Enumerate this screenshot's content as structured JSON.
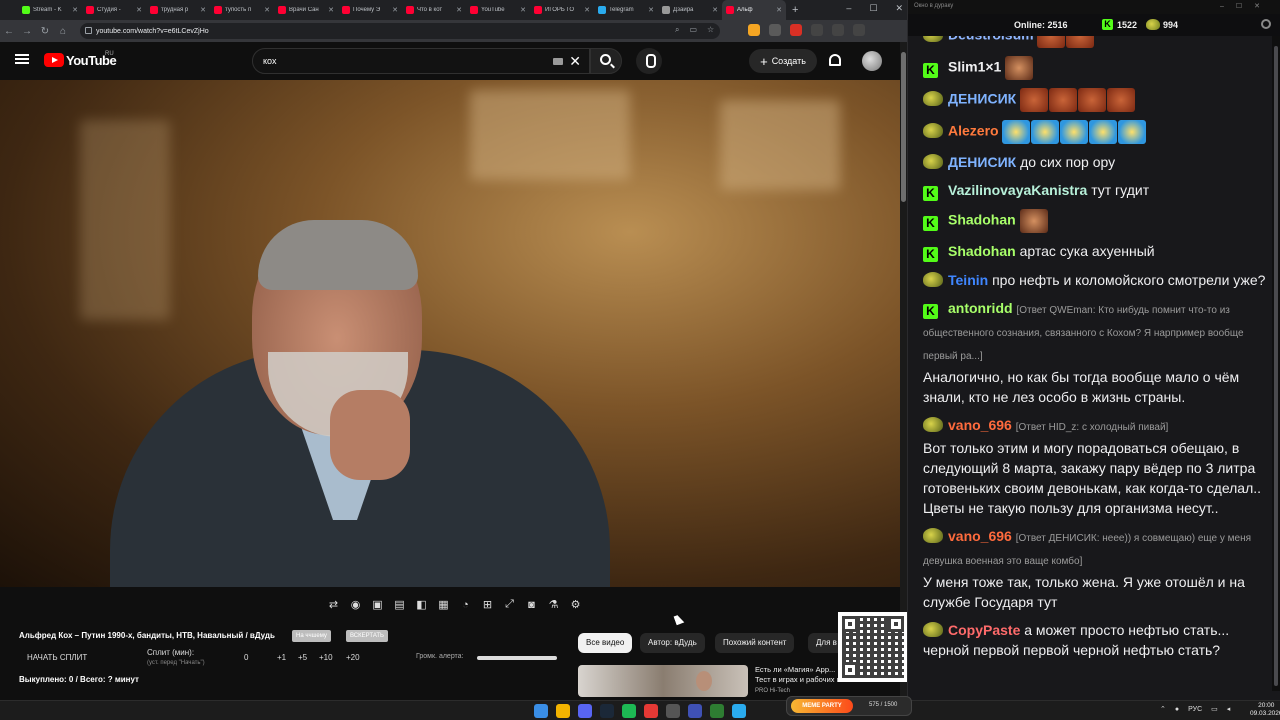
{
  "browser": {
    "tabs": [
      {
        "label": "Stream - K",
        "color": "#53fc18"
      },
      {
        "label": "Студия -",
        "color": "#ff0033"
      },
      {
        "label": "трудная р",
        "color": "#ff0033"
      },
      {
        "label": "тупость п",
        "color": "#ff0033"
      },
      {
        "label": "Врачи Сан",
        "color": "#ff0033"
      },
      {
        "label": "Почему Э",
        "color": "#ff0033"
      },
      {
        "label": "Что в кот",
        "color": "#ff0033"
      },
      {
        "label": "YouTube",
        "color": "#ff0033"
      },
      {
        "label": "ИГОРЬ ГО",
        "color": "#ff0033"
      },
      {
        "label": "Telegram",
        "color": "#2aabee"
      },
      {
        "label": "Дзайра",
        "color": "#999999"
      },
      {
        "label": "Альф",
        "color": "#ff0033",
        "active": true
      }
    ],
    "url": "youtube.com/watch?v=e6tLCevZjHo"
  },
  "youtube": {
    "logo_text": "YouTube",
    "region": "RU",
    "search_value": "кох",
    "create_label": "Создать",
    "video_title": "Альфред Кох – Путин 1990-х, бандиты, НТВ, Навальный / вДудь",
    "pill_1": "На ччшему",
    "pill_2": "ВСКЕРТАТЬ",
    "split_button": "НАЧАТЬ СПЛИТ",
    "split_label": "Сплит (мин):",
    "split_hint": "(уст. перед \"Начать\")",
    "split_values": [
      "0",
      "+1",
      "+5",
      "+10",
      "+20"
    ],
    "alert_label": "Громк. алерта:",
    "alert_volume": 1.0,
    "bought": "Выкуплено: 0 / Всего: ? минут",
    "chips": [
      "Все видео",
      "Автор: вДудь",
      "Похожий контент",
      "Для в"
    ],
    "rec_title": "Есть ли «Магия» Арр... Тест в играх и рабочих п...",
    "rec_sub": "PRO Hi-Tech"
  },
  "chat": {
    "window_title": "Окно в дураку",
    "online_label": "Online:",
    "online_count": "2516",
    "kick_count": "1522",
    "pepe_count": "994",
    "messages": [
      {
        "badge": "pepe",
        "user": "Deustroisum",
        "color": "#8fb6ff",
        "text": "",
        "emotes": [
          "red",
          "red"
        ]
      },
      {
        "badge": "k",
        "user": "Slim1×1",
        "color": "#efeff1",
        "text": "",
        "emotes": [
          "face"
        ]
      },
      {
        "badge": "pepe",
        "user": "ДЕНИСИК",
        "color": "#7fb3ff",
        "text": "",
        "emotes": [
          "red",
          "red",
          "red",
          "red"
        ]
      },
      {
        "badge": "pepe",
        "user": "Alezero",
        "color": "#ff7a3d",
        "text": "",
        "emotes": [
          "lol",
          "lol",
          "lol",
          "lol",
          "lol"
        ]
      },
      {
        "badge": "pepe",
        "user": "ДЕНИСИК",
        "color": "#7fb3ff",
        "text": "до сих пор ору",
        "emotes": []
      },
      {
        "badge": "k",
        "user": "VazilinovayaKanistra",
        "color": "#b7f0d9",
        "text": "тут гудит",
        "emotes": []
      },
      {
        "badge": "k",
        "user": "Shadohan",
        "color": "#a8ff6a",
        "text": "",
        "emotes": [
          "face"
        ]
      },
      {
        "badge": "k",
        "user": "Shadohan",
        "color": "#a8ff6a",
        "text": "артас сука ахуенный",
        "emotes": []
      },
      {
        "badge": "pepe",
        "user": "Teinin",
        "color": "#3f86ff",
        "text": "про нефть и коломойского смотрели уже?",
        "emotes": []
      },
      {
        "badge": "k",
        "user": "antonridd",
        "color": "#a8ff6a",
        "reply": "[Ответ QWEman: Кто нибудь помнит что-то из общественного сознания, связанного с Кохом? Я нарпример вообще первый ра...]",
        "text": "Аналогично, но как бы тогда вообще мало о чём знали, кто не лез особо в жизнь страны.",
        "emotes": []
      },
      {
        "badge": "pepe",
        "user": "vano_696",
        "color": "#ff6b3d",
        "reply": "[Ответ HID_z: с холодный пивай]",
        "text": "Вот только этим и могу порадоваться обещаю, в следующий 8 марта, закажу пару вёдер по 3 литра готовеньких своим девонькам, как когда-то сделал.. Цветы не такую пользу для организма несут..",
        "emotes": []
      },
      {
        "badge": "pepe",
        "user": "vano_696",
        "color": "#ff6b3d",
        "reply": "[Ответ ДЕНИСИК: нееe)) я совмещаю) еще у меня девушка военная  это ваще комбо]",
        "text": "У меня тоже так, только жена. Я уже отошёл и на службе Государя тут",
        "emotes": []
      },
      {
        "badge": "pepe",
        "user": "CopyPaste",
        "color": "#ff6b6b",
        "text": "а может просто нефтью стать... черной первой первой черной нефтью стать?",
        "emotes": []
      }
    ]
  },
  "taskbar": {
    "widget_label": "MEME PARTY",
    "widget_count": "575 / 1500",
    "lang": "РУС",
    "time": "20:00",
    "date": "09.03.2026"
  },
  "colors": {
    "accent_red": "#ff0000",
    "kick_green": "#53fc18"
  }
}
